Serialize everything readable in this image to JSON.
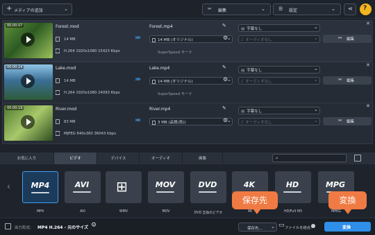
{
  "toolbar": {
    "add_media": "メディアの追加",
    "edit": "編集",
    "settings": "設定"
  },
  "files": [
    {
      "duration": "00:00:07",
      "src_name": "Forest.mod",
      "src_size": "14 MB",
      "src_info": "H.264 1920x1080 15423 Kbps",
      "out_name": "Forest.mp4",
      "out_size": "14 MB (オリジナル)",
      "superspeed": "SuperSpeed モード",
      "subtitle": "字幕なし",
      "audio": "オーディオなし",
      "edit": "編集"
    },
    {
      "duration": "00:00:24",
      "src_name": "Lake.mod",
      "src_size": "14 MB",
      "src_info": "H.264 1920x1080 24093 Kbps",
      "out_name": "Lake.mp4",
      "out_size": "14 MB (オリジナル)",
      "superspeed": "SuperSpeed モード",
      "subtitle": "字幕なし",
      "audio": "オーディオなし",
      "edit": "編集"
    },
    {
      "duration": "00:00:19",
      "src_name": "River.mod",
      "src_size": "83 MB",
      "src_info": "MJPEG 640x360 36043 Kbps",
      "out_name": "River.mp4",
      "out_size": "3 MB (品質(良))",
      "superspeed": "",
      "subtitle": "字幕なし",
      "audio": "オーディオなし",
      "edit": "編集"
    }
  ],
  "tabs": [
    "お気に入り",
    "ビデオ",
    "デバイス",
    "オーディオ",
    "画像"
  ],
  "formats": [
    {
      "logo": "MP4",
      "label": "MP4"
    },
    {
      "logo": "AVI",
      "label": "AVI"
    },
    {
      "logo": "",
      "label": "WMV"
    },
    {
      "logo": "MOV",
      "label": "MOV"
    },
    {
      "logo": "DVD",
      "label": "DVD 互換のビデオ"
    },
    {
      "logo": "4K",
      "label": "4K"
    },
    {
      "logo": "HD",
      "label": "HD/Full HD"
    },
    {
      "logo": "MPG",
      "label": "MPEG"
    }
  ],
  "bottom": {
    "output_label": "出力形式:",
    "output_value": "MP4 H.264 - 元のサイズ",
    "save_to": "保存先...",
    "merge": "ファイルを結合:",
    "convert": "変換"
  },
  "callouts": {
    "save": "保存先",
    "convert": "変換"
  },
  "colors": {
    "accent": "#2f8ee8",
    "callout": "#f07a43"
  }
}
